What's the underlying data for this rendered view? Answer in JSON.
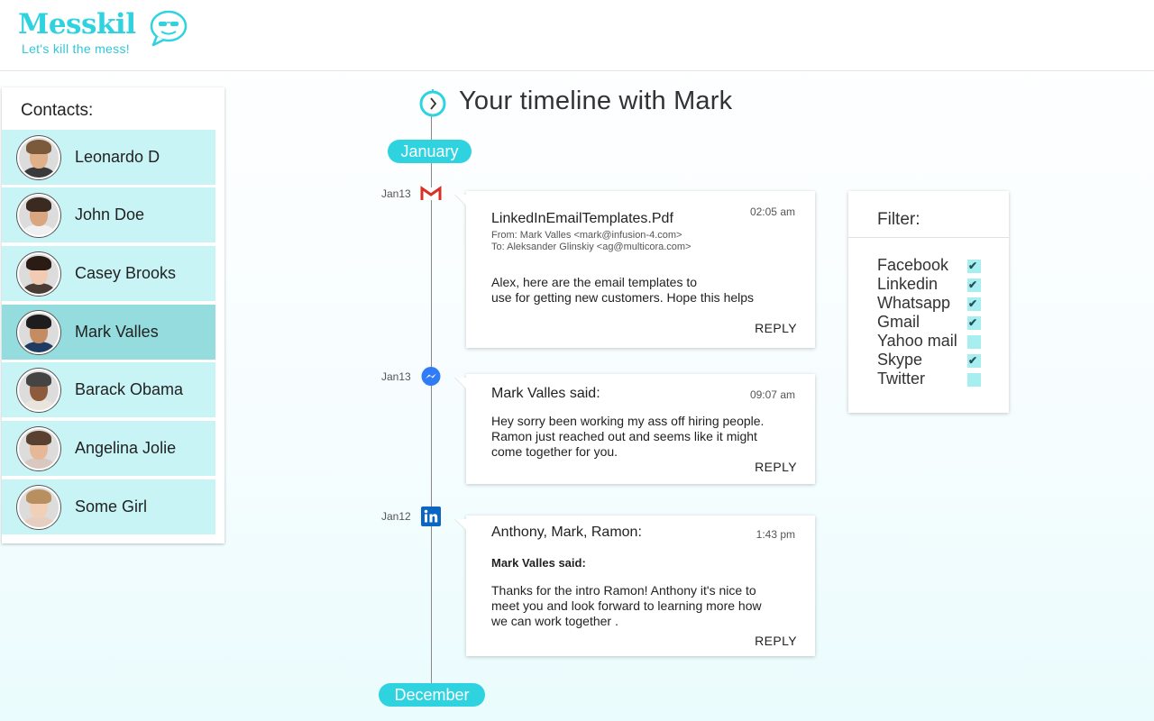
{
  "header": {
    "logo_name": "Messkil",
    "tagline": "Let's kill the mess!"
  },
  "contacts": {
    "title": "Contacts:",
    "items": [
      {
        "name": "Leonardo D",
        "selected": false,
        "skin": "#e0b089",
        "hair": "#7a5a3a",
        "shirt": "#3a3a3a"
      },
      {
        "name": "John Doe",
        "selected": false,
        "skin": "#d9a67f",
        "hair": "#3b2a1f",
        "shirt": "#f0f0f0"
      },
      {
        "name": "Casey Brooks",
        "selected": false,
        "skin": "#f1cbb3",
        "hair": "#2a1b15",
        "shirt": "#4a3b35"
      },
      {
        "name": "Mark Valles",
        "selected": true,
        "skin": "#c58c62",
        "hair": "#1d1d1d",
        "shirt": "#1f3b62"
      },
      {
        "name": "Barack Obama",
        "selected": false,
        "skin": "#8d5a3b",
        "hair": "#444444",
        "shirt": "#e9e4dc"
      },
      {
        "name": "Angelina Jolie",
        "selected": false,
        "skin": "#e6b897",
        "hair": "#5a4030",
        "shirt": "#d8c8c0"
      },
      {
        "name": "Some Girl",
        "selected": false,
        "skin": "#f2d0b8",
        "hair": "#b89060",
        "shirt": "#e6cfc0"
      }
    ]
  },
  "timeline": {
    "title": "Your timeline with Mark",
    "start_month": "January",
    "end_month": "December"
  },
  "messages": [
    {
      "date": "Jan13",
      "source": "gmail-icon",
      "title": "LinkedInEmailTemplates.Pdf",
      "time": "02:05 am",
      "from": "From: Mark Valles <mark@infusion-4.com>",
      "to": "To: Aleksander Glinskiy <ag@multicora.com>",
      "body": "Alex, here are the email templates to\nuse for getting new customers. Hope this helps",
      "reply": "REPLY"
    },
    {
      "date": "Jan13",
      "source": "messenger-icon",
      "title": "Mark Valles said:",
      "time": "09:07 am",
      "body": "Hey sorry been working my ass off hiring people.\nRamon just reached out and seems like it might\ncome together for you.",
      "reply": "REPLY"
    },
    {
      "date": "Jan12",
      "source": "linkedin-icon",
      "title": "Anthony, Mark, Ramon:",
      "time": "1:43 pm",
      "subtitle": "Mark Valles said:",
      "body": "Thanks for the intro Ramon! Anthony it's nice to\nmeet you and look forward to learning more how\nwe can work together .",
      "reply": "REPLY"
    }
  ],
  "filter": {
    "title": "Filter:",
    "options": [
      {
        "label": "Facebook",
        "checked": true
      },
      {
        "label": "Linkedin",
        "checked": true
      },
      {
        "label": "Whatsapp",
        "checked": true
      },
      {
        "label": "Gmail",
        "checked": true
      },
      {
        "label": "Yahoo mail",
        "checked": false
      },
      {
        "label": "Skype",
        "checked": true
      },
      {
        "label": "Twitter",
        "checked": false
      }
    ]
  },
  "colors": {
    "accent": "#2fd3df",
    "contact_bg": "#c9f4f6",
    "contact_selected_bg": "#94dcde",
    "checkbox_bg": "#a7eef0",
    "gmail_red": "#d93025",
    "messenger_blue": "#2f7cf6",
    "linkedin_blue": "#0a66c2"
  }
}
